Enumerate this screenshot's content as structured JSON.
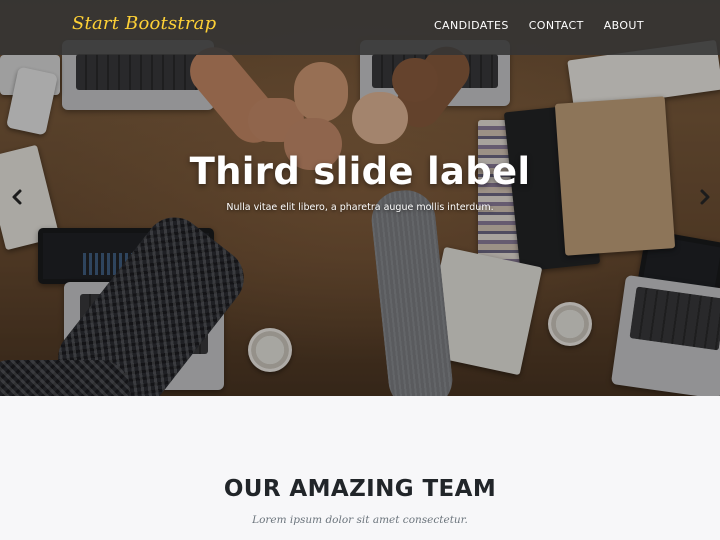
{
  "navbar": {
    "brand": "Start Bootstrap",
    "links": [
      {
        "label": "CANDIDATES"
      },
      {
        "label": "CONTACT"
      },
      {
        "label": "ABOUT"
      }
    ]
  },
  "carousel": {
    "slide_title": "Third slide label",
    "slide_text": "Nulla vitae elit libero, a pharetra augue mollis interdum.",
    "prev_icon": "chevron-left-icon",
    "next_icon": "chevron-right-icon"
  },
  "team": {
    "heading": "OUR AMAZING TEAM",
    "subheading": "Lorem ipsum dolor sit amet consectetur."
  },
  "colors": {
    "brand": "#fed136",
    "navbar_bg": "#343434",
    "heading": "#212529",
    "muted": "#6c757d",
    "section_bg": "#f7f7f9"
  }
}
